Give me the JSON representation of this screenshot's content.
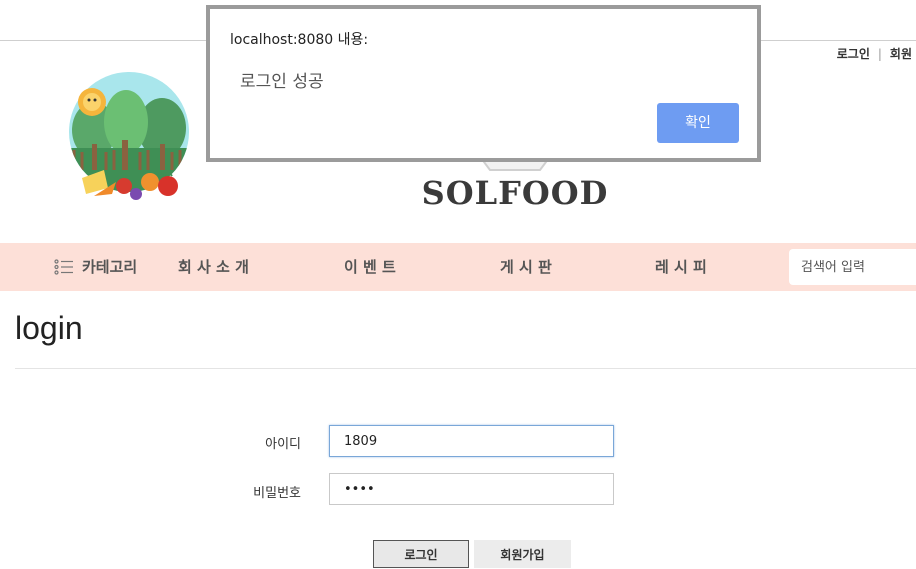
{
  "header": {
    "login_link": "로그인",
    "separator": "|",
    "join_link": "회원",
    "brand_name": "SOLFOOD"
  },
  "nav": {
    "category_label": "카테고리",
    "items": [
      "회 사 소 개",
      "이 벤 트",
      "게 시 판",
      "레 시 피"
    ],
    "search_placeholder": "검색어 입력"
  },
  "page": {
    "title": "login"
  },
  "form": {
    "id_label": "아이디",
    "id_value": "1809",
    "password_label": "비밀번호",
    "password_value": "••••",
    "login_button": "로그인",
    "join_button": "회원가입"
  },
  "dialog": {
    "origin": "localhost:8080 내용:",
    "message": "로그인 성공",
    "ok_button": "확인"
  },
  "colors": {
    "nav_background": "#fde0d8",
    "dialog_ok": "#6e9cf2",
    "dialog_border": "#9b9b9b"
  },
  "icons": {
    "category": "list-icon",
    "logo": "forest-food-logo-icon"
  }
}
